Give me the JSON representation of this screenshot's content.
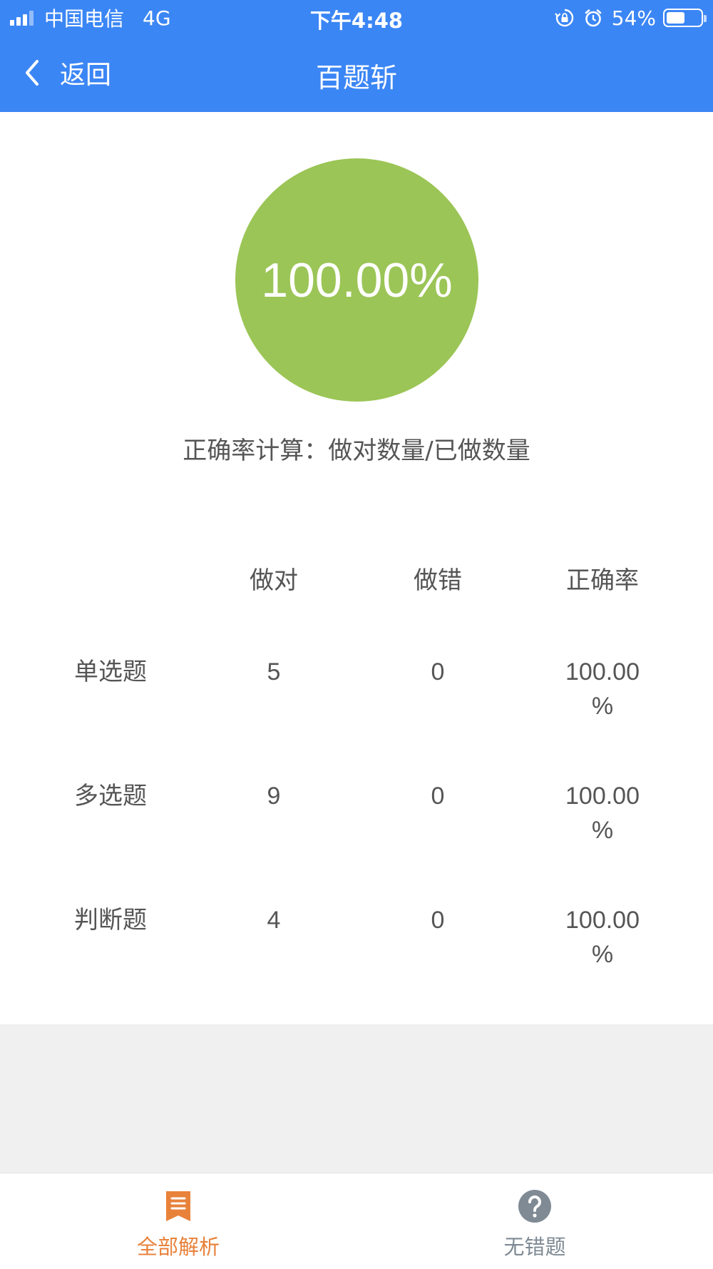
{
  "status_bar": {
    "carrier": "中国电信",
    "network": "4G",
    "time": "下午4:48",
    "battery_percent": "54%",
    "battery_level": 0.54,
    "icons": [
      "signal-icon",
      "rotation-lock-icon",
      "alarm-icon",
      "battery-icon"
    ]
  },
  "nav": {
    "back_label": "返回",
    "title": "百题斩"
  },
  "score": {
    "value": "100.00%",
    "color": "#9bc556"
  },
  "formula_note": "正确率计算：做对数量/已做数量",
  "stats": {
    "headers": [
      "",
      "做对",
      "做错",
      "正确率"
    ],
    "rows": [
      {
        "type": "单选题",
        "correct": "5",
        "wrong": "0",
        "rate_line1": "100.00",
        "rate_line2": "%"
      },
      {
        "type": "多选题",
        "correct": "9",
        "wrong": "0",
        "rate_line1": "100.00",
        "rate_line2": "%"
      },
      {
        "type": "判断题",
        "correct": "4",
        "wrong": "0",
        "rate_line1": "100.00",
        "rate_line2": "%"
      }
    ]
  },
  "tabs": [
    {
      "label": "全部解析",
      "icon": "list-bookmark-icon",
      "active": true
    },
    {
      "label": "无错题",
      "icon": "question-circle-icon",
      "active": false
    }
  ],
  "colors": {
    "header_blue": "#3b86f5",
    "active_tab": "#e8823b",
    "inactive_tab": "#7f8a94",
    "background_gray": "#f0f0f0"
  }
}
